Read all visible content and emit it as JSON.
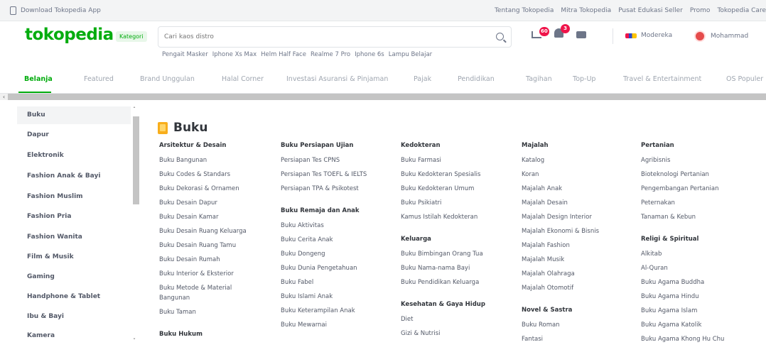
{
  "topbar": {
    "download_label": "Download Tokopedia App",
    "links": [
      "Tentang Tokopedia",
      "Mitra Tokopedia",
      "Pusat Edukasi Seller",
      "Promo",
      "Tokopedia Care"
    ]
  },
  "header": {
    "logo": "tokopedia",
    "kategori_label": "Kategori",
    "search_placeholder": "Cari kaos distro",
    "trending": [
      "Pengait Masker",
      "Iphone Xs Max",
      "Helm Half Face",
      "Realme 7 Pro",
      "Iphone 6s",
      "Lampu Belajar"
    ],
    "cart_count": "60",
    "notif_count": "3",
    "store_name": "Modereka",
    "user_name": "Mohammad"
  },
  "nav_tabs": [
    "Belanja",
    "Featured",
    "Brand Unggulan",
    "Halal Corner",
    "Investasi Asuransi & Pinjaman",
    "Pajak",
    "Pendidikan",
    "Tagihan",
    "Top-Up",
    "Travel & Entertainment",
    "OS Populer"
  ],
  "sidebar": {
    "active": "Buku",
    "items": [
      "Buku",
      "Dapur",
      "Elektronik",
      "Fashion Anak & Bayi",
      "Fashion Muslim",
      "Fashion Pria",
      "Fashion Wanita",
      "Film & Musik",
      "Gaming",
      "Handphone & Tablet",
      "Ibu & Bayi",
      "Kamera"
    ]
  },
  "main": {
    "title": "Buku",
    "columns": [
      {
        "groups": [
          {
            "head": "Arsitektur & Desain",
            "links": [
              "Buku Bangunan",
              "Buku Codes & Standars",
              "Buku Dekorasi & Ornamen",
              "Buku Desain Dapur",
              "Buku Desain Kamar",
              "Buku Desain Ruang Keluarga",
              "Buku Desain Ruang Tamu",
              "Buku Desain Rumah",
              "Buku Interior & Eksterior",
              "Buku Metode & Material",
              "Bangunan",
              "Buku Taman"
            ]
          },
          {
            "head": "Buku Hukum",
            "links": []
          }
        ]
      },
      {
        "groups": [
          {
            "head": "Buku Persiapan Ujian",
            "links": [
              "Persiapan Tes CPNS",
              "Persiapan Tes TOEFL & IELTS",
              "Persiapan TPA & Psikotest"
            ]
          },
          {
            "head": "Buku Remaja dan Anak",
            "links": [
              "Buku Aktivitas",
              "Buku Cerita Anak",
              "Buku Dongeng",
              "Buku Dunia Pengetahuan",
              "Buku Fabel",
              "Buku Islami Anak",
              "Buku Keterampilan Anak",
              "Buku Mewarnai"
            ]
          }
        ]
      },
      {
        "groups": [
          {
            "head": "Kedokteran",
            "links": [
              "Buku Farmasi",
              "Buku Kedokteran Spesialis",
              "Buku Kedokteran Umum",
              "Buku Psikiatri",
              "Kamus Istilah Kedokteran"
            ]
          },
          {
            "head": "Keluarga",
            "links": [
              "Buku Bimbingan Orang Tua",
              "Buku Nama-nama Bayi",
              "Buku Pendidikan Keluarga"
            ]
          },
          {
            "head": "Kesehatan & Gaya Hidup",
            "links": [
              "Diet",
              "Gizi & Nutrisi"
            ]
          }
        ]
      },
      {
        "groups": [
          {
            "head": "Majalah",
            "links": [
              "Katalog",
              "Koran",
              "Majalah Anak",
              "Majalah Desain",
              "Majalah Design Interior",
              "Majalah Ekonomi & Bisnis",
              "Majalah Fashion",
              "Majalah Musik",
              "Majalah Olahraga",
              "Majalah Otomotif"
            ]
          },
          {
            "head": "Novel & Sastra",
            "links": [
              "Buku Roman",
              "Fantasi"
            ]
          }
        ]
      },
      {
        "groups": [
          {
            "head": "Pertanian",
            "links": [
              "Agribisnis",
              "Bioteknologi Pertanian",
              "Pengembangan Pertanian",
              "Peternakan",
              "Tanaman & Kebun"
            ]
          },
          {
            "head": "Religi & Spiritual",
            "links": [
              "Alkitab",
              "Al-Quran",
              "Buku Agama Buddha",
              "Buku Agama Hindu",
              "Buku Agama Islam",
              "Buku Agama Katolik",
              "Buku Agama Khong Hu Chu"
            ]
          }
        ]
      }
    ]
  },
  "colors": {
    "brand": "#03ac0e",
    "badge": "#ef144a"
  }
}
